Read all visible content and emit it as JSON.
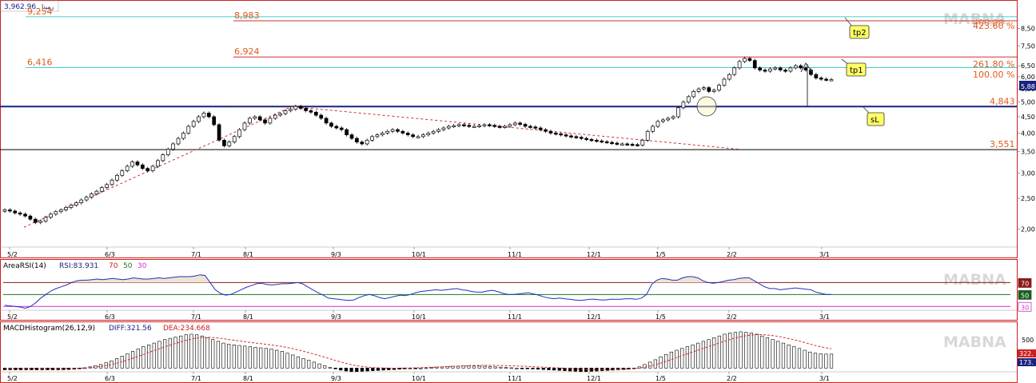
{
  "watermark": "MABNA",
  "header": {
    "last_price": "3,962.96",
    "symbol": "رمپنا"
  },
  "xticks": [
    "5/2",
    "6/3",
    "7/1",
    "8/1",
    "9/3",
    "10/1",
    "11/1",
    "12/1",
    "1/5",
    "2/2",
    "3/1"
  ],
  "chart_data": [
    {
      "type": "candlestick",
      "ylim": [
        1800,
        10200
      ],
      "yscale": "log",
      "yticks": [
        "8,50",
        "7,50",
        "6,50",
        "6,00",
        "5,50",
        "5,00",
        "4,50",
        "4,00",
        "3,50",
        "3,00",
        "2,50",
        "2,00"
      ],
      "last_value_badge": "5,88",
      "levels": [
        {
          "label": "9,254",
          "value": 9254,
          "color": "#3fd0d0",
          "label_color": "#e05a1a"
        },
        {
          "label": "8,983",
          "value": 8983,
          "color": "#d03030",
          "label_color": "#e05a1a"
        },
        {
          "label": "6,924",
          "value": 6924,
          "color": "#d03030",
          "label_color": "#e05a1a"
        },
        {
          "label": "6,416",
          "value": 6416,
          "color": "#3fd0d0",
          "label_color": "#e05a1a"
        },
        {
          "label": "4,843",
          "value": 4843,
          "color": "#1a237e",
          "label_color": "#e05a1a"
        },
        {
          "label": "3,551",
          "value": 3551,
          "color": "#000000",
          "label_color": "#e05a1a"
        }
      ],
      "fib_labels": [
        "423.60 %",
        "261.80 %",
        "100.00 %"
      ],
      "fib_overlap_text": "400.00",
      "callouts": [
        "tp2",
        "tp1",
        "sL"
      ],
      "series_close": [
        2300,
        2280,
        2250,
        2230,
        2200,
        2150,
        2100,
        2120,
        2180,
        2230,
        2270,
        2300,
        2340,
        2380,
        2420,
        2470,
        2520,
        2580,
        2630,
        2700,
        2760,
        2850,
        2950,
        3050,
        3150,
        3250,
        3180,
        3100,
        3050,
        3150,
        3280,
        3420,
        3560,
        3700,
        3850,
        4000,
        4200,
        4350,
        4500,
        4620,
        4500,
        4250,
        3800,
        3650,
        3750,
        3900,
        4100,
        4300,
        4450,
        4500,
        4400,
        4300,
        4450,
        4550,
        4600,
        4700,
        4750,
        4850,
        4780,
        4700,
        4650,
        4550,
        4450,
        4300,
        4200,
        4150,
        4100,
        3950,
        3850,
        3750,
        3700,
        3800,
        3900,
        3950,
        4000,
        4050,
        4100,
        4050,
        4000,
        3950,
        3900,
        3900,
        3950,
        4000,
        4050,
        4100,
        4150,
        4200,
        4220,
        4250,
        4230,
        4200,
        4200,
        4220,
        4250,
        4230,
        4200,
        4180,
        4200,
        4250,
        4300,
        4260,
        4200,
        4180,
        4150,
        4100,
        4050,
        4000,
        3980,
        3950,
        3920,
        3900,
        3880,
        3850,
        3820,
        3800,
        3780,
        3760,
        3740,
        3720,
        3700,
        3700,
        3690,
        3680,
        3670,
        3800,
        4050,
        4200,
        4350,
        4400,
        4450,
        4500,
        4800,
        5000,
        5200,
        5400,
        5500,
        5550,
        5400,
        5450,
        5650,
        5900,
        6100,
        6400,
        6700,
        6850,
        6750,
        6400,
        6300,
        6250,
        6350,
        6400,
        6300,
        6250,
        6400,
        6500,
        6400,
        6300,
        6100,
        5950,
        5900,
        5880,
        5880
      ],
      "trend_dashed": {
        "color": "#d03030"
      }
    },
    {
      "type": "area",
      "title": "AreaRSI(14)",
      "value_label": "RSI:83.931",
      "levels_text": [
        "70",
        "50",
        "30"
      ],
      "levels": [
        70,
        50,
        30
      ],
      "ylim": [
        25,
        88
      ],
      "values": [
        32,
        31,
        30,
        29,
        27,
        30,
        36,
        44,
        50,
        56,
        60,
        63,
        66,
        70,
        73,
        74,
        74,
        75,
        76,
        75,
        76,
        77,
        76,
        75,
        76,
        78,
        77,
        76,
        76,
        77,
        78,
        77,
        78,
        79,
        80,
        80,
        80,
        81,
        83,
        82,
        70,
        58,
        52,
        49,
        50,
        54,
        58,
        62,
        65,
        68,
        69,
        67,
        66,
        67,
        68,
        68,
        69,
        70,
        68,
        63,
        58,
        53,
        49,
        44,
        43,
        42,
        41,
        40,
        41,
        45,
        48,
        50,
        48,
        45,
        43,
        45,
        47,
        49,
        48,
        50,
        53,
        55,
        56,
        57,
        58,
        57,
        58,
        59,
        60,
        58,
        57,
        55,
        54,
        54,
        56,
        57,
        55,
        52,
        50,
        50,
        51,
        52,
        53,
        51,
        49,
        46,
        44,
        43,
        44,
        43,
        42,
        41,
        40,
        41,
        42,
        42,
        41,
        41,
        42,
        42,
        42,
        43,
        43,
        42,
        44,
        50,
        67,
        74,
        77,
        76,
        74,
        74,
        78,
        80,
        80,
        78,
        73,
        70,
        69,
        70,
        72,
        74,
        75,
        77,
        78,
        78,
        73,
        68,
        63,
        60,
        60,
        58,
        59,
        60,
        61,
        60,
        59,
        58,
        54,
        52,
        50,
        50
      ],
      "badges": [
        "70",
        "50",
        "30"
      ]
    },
    {
      "type": "bar",
      "title": "MACDHistogram(26,12,9)",
      "value_labels": [
        "DIFF:321.56",
        "DEA:234.668"
      ],
      "ytick": "500",
      "badges": [
        "322.",
        "173."
      ],
      "ylim": [
        -50,
        650
      ],
      "values": [
        -30,
        -30,
        -30,
        -30,
        -30,
        -30,
        -30,
        -30,
        -30,
        -30,
        -30,
        -28,
        -25,
        -20,
        -10,
        5,
        20,
        40,
        60,
        90,
        120,
        160,
        200,
        240,
        280,
        320,
        360,
        390,
        420,
        450,
        480,
        500,
        520,
        540,
        560,
        570,
        560,
        540,
        510,
        480,
        450,
        420,
        400,
        390,
        380,
        370,
        360,
        350,
        340,
        330,
        320,
        300,
        280,
        250,
        220,
        190,
        160,
        130,
        100,
        70,
        40,
        10,
        -15,
        -35,
        -50,
        -60,
        -60,
        -55,
        -50,
        -45,
        -40,
        -35,
        -30,
        -25,
        -20,
        -15,
        -10,
        -5,
        0,
        5,
        10,
        15,
        20,
        25,
        30,
        32,
        34,
        35,
        34,
        32,
        30,
        25,
        20,
        15,
        10,
        5,
        0,
        -5,
        -10,
        -15,
        -20,
        -25,
        -30,
        -35,
        -40,
        -45,
        -50,
        -55,
        -60,
        -60,
        -55,
        -50,
        -45,
        -40,
        -35,
        -30,
        -25,
        -20,
        -10,
        20,
        60,
        100,
        140,
        190,
        230,
        270,
        300,
        330,
        360,
        390,
        420,
        450,
        480,
        510,
        540,
        570,
        590,
        600,
        610,
        600,
        590,
        570,
        540,
        510,
        480,
        450,
        420,
        390,
        360,
        330,
        300,
        270,
        250,
        240,
        235,
        235
      ],
      "signal_dashed": {
        "color": "#d03030"
      }
    }
  ]
}
